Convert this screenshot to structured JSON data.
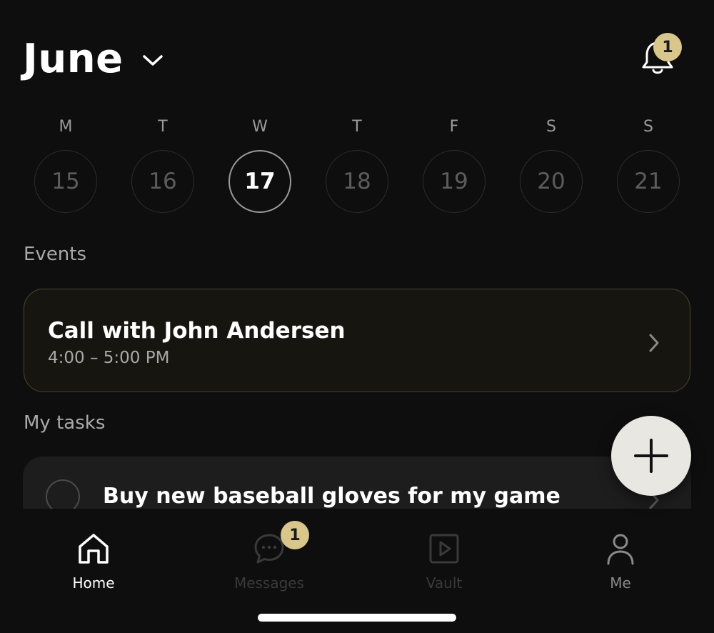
{
  "header": {
    "month": "June",
    "notification_count": "1"
  },
  "week": {
    "days": [
      {
        "letter": "M",
        "date": "15",
        "selected": false
      },
      {
        "letter": "T",
        "date": "16",
        "selected": false
      },
      {
        "letter": "W",
        "date": "17",
        "selected": true
      },
      {
        "letter": "T",
        "date": "18",
        "selected": false
      },
      {
        "letter": "F",
        "date": "19",
        "selected": false
      },
      {
        "letter": "S",
        "date": "20",
        "selected": false
      },
      {
        "letter": "S",
        "date": "21",
        "selected": false
      }
    ]
  },
  "events": {
    "label": "Events",
    "items": [
      {
        "title": "Call with John Andersen",
        "time": "4:00 – 5:00 PM"
      }
    ]
  },
  "tasks": {
    "label": "My tasks",
    "items": [
      {
        "title": "Buy new baseball gloves for my game"
      }
    ]
  },
  "fab": {
    "icon": "plus-icon"
  },
  "nav": {
    "items": [
      {
        "label": "Home",
        "icon": "home-icon",
        "active": true
      },
      {
        "label": "Messages",
        "icon": "chat-bubble-icon",
        "badge": "1"
      },
      {
        "label": "Vault",
        "icon": "play-square-icon"
      },
      {
        "label": "Me",
        "icon": "person-icon"
      }
    ]
  },
  "colors": {
    "background": "#0e0e0e",
    "accent_badge": "#d8c68a",
    "event_border": "#4a4630",
    "fab": "#e9e7e1"
  }
}
